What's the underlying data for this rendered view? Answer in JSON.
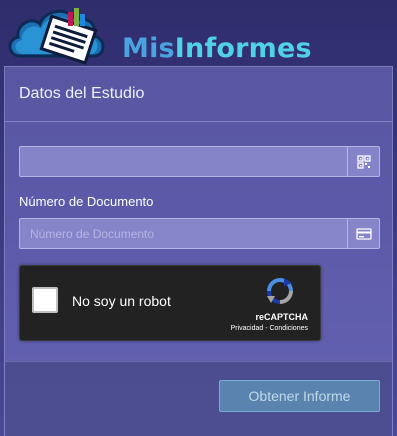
{
  "brand": {
    "part1": "Mis",
    "part2": "Informes"
  },
  "card": {
    "title": "Datos del Estudio",
    "field1": {
      "value": "",
      "placeholder": "",
      "icon": "qr-code-icon"
    },
    "document": {
      "label": "Número de Documento",
      "value": "",
      "placeholder": "Número de Documento",
      "icon": "id-card-icon"
    },
    "captcha": {
      "label": "No soy un robot",
      "brand": "reCAPTCHA",
      "links": "Privacidad - Condiciones",
      "checked": false
    },
    "submit_label": "Obtener Informe"
  },
  "colors": {
    "brand_primary": "#4aa3df",
    "brand_secondary": "#4fd1e8",
    "button": "#5f96b9"
  }
}
